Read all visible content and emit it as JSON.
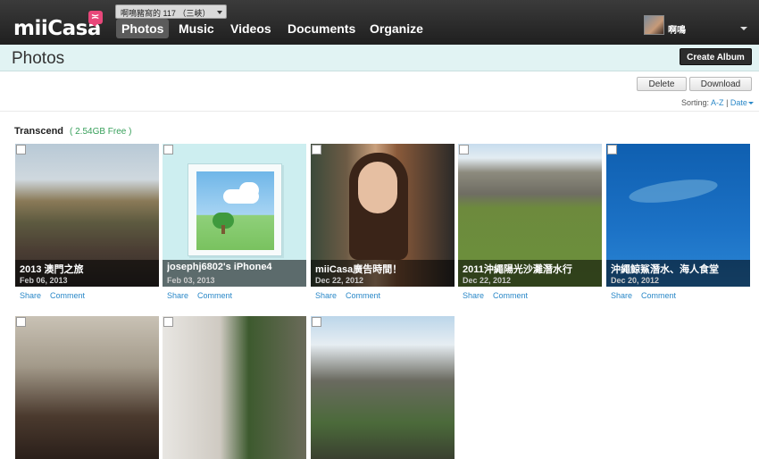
{
  "app": {
    "logo_text": "miiCasa",
    "logo_badge": "≍"
  },
  "device_selector": {
    "value": "啊鳴豬窩的 117 （三峽）"
  },
  "nav": {
    "items": [
      {
        "label": "Photos",
        "active": true
      },
      {
        "label": "Music",
        "active": false
      },
      {
        "label": "Videos",
        "active": false
      },
      {
        "label": "Documents",
        "active": false
      },
      {
        "label": "Organize",
        "active": false
      }
    ]
  },
  "user": {
    "name": "啊鳴"
  },
  "page": {
    "title": "Photos",
    "create_album_label": "Create Album"
  },
  "actions": {
    "delete_label": "Delete",
    "download_label": "Download"
  },
  "sorting": {
    "label": "Sorting:",
    "az": "A-Z",
    "separator": "|",
    "date": "Date"
  },
  "storage": {
    "name": "Transcend",
    "free": "( 2.54GB Free )"
  },
  "card_links": {
    "share": "Share",
    "comment": "Comment"
  },
  "albums": [
    {
      "name": "2013 澳門之旅",
      "date": "Feb 06, 2013"
    },
    {
      "name": "josephj6802's iPhone4",
      "date": "Feb 03, 2013"
    },
    {
      "name": "miiCasa廣告時間！",
      "date": "Dec 22, 2012"
    },
    {
      "name": "2011沖繩陽光沙灘潛水行",
      "date": "Dec 22, 2012"
    },
    {
      "name": "沖繩鯨鯊潛水、海人食堂",
      "date": "Dec 20, 2012"
    },
    {
      "name": "",
      "date": ""
    },
    {
      "name": "",
      "date": ""
    },
    {
      "name": "",
      "date": ""
    }
  ],
  "colors": {
    "accent": "#2a88c8",
    "free_text": "#38a05b",
    "title_bar": "#e1f3f3",
    "topbar": "#2a2a2a"
  }
}
